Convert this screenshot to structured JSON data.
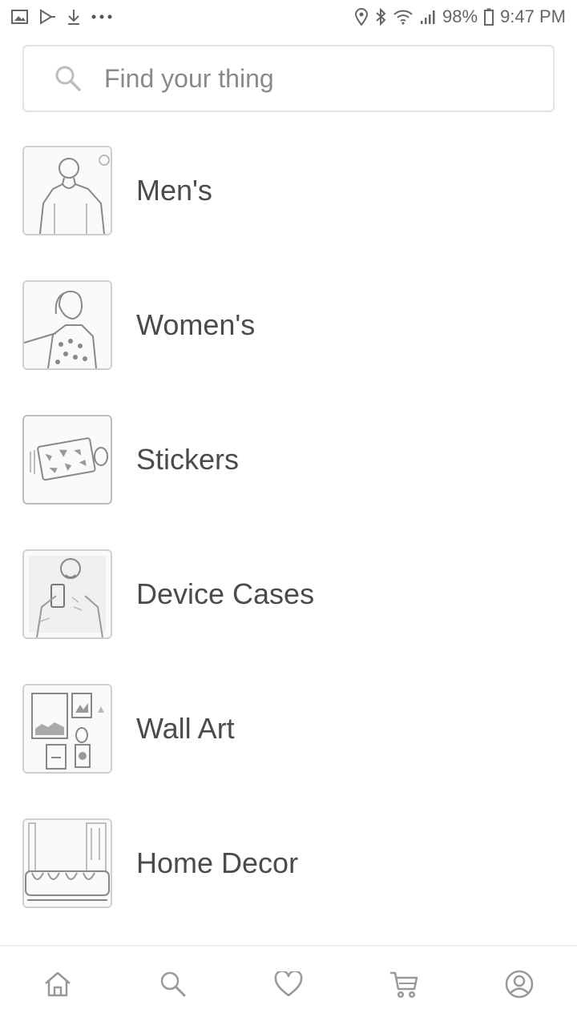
{
  "status_bar": {
    "battery": "98%",
    "time": "9:47 PM",
    "left_icons": [
      "gallery-icon",
      "play-store-icon",
      "download-icon",
      "more-dots-icon"
    ],
    "right_icons": [
      "location-icon",
      "bluetooth-icon",
      "wifi-icon",
      "signal-icon",
      "battery-icon"
    ]
  },
  "search": {
    "placeholder": "Find your thing",
    "value": ""
  },
  "categories": [
    {
      "label": "Men's",
      "icon": "mens-thumbnail"
    },
    {
      "label": "Women's",
      "icon": "womens-thumbnail"
    },
    {
      "label": "Stickers",
      "icon": "stickers-thumbnail"
    },
    {
      "label": "Device Cases",
      "icon": "device-cases-thumbnail"
    },
    {
      "label": "Wall Art",
      "icon": "wall-art-thumbnail"
    },
    {
      "label": "Home Decor",
      "icon": "home-decor-thumbnail"
    }
  ],
  "bottom_nav": [
    {
      "icon": "home-icon"
    },
    {
      "icon": "search-icon"
    },
    {
      "icon": "heart-icon"
    },
    {
      "icon": "cart-icon"
    },
    {
      "icon": "account-icon"
    }
  ],
  "colors": {
    "text": "#4b4b4b",
    "border": "#e2e2e2",
    "icon": "#8a8a8a"
  }
}
